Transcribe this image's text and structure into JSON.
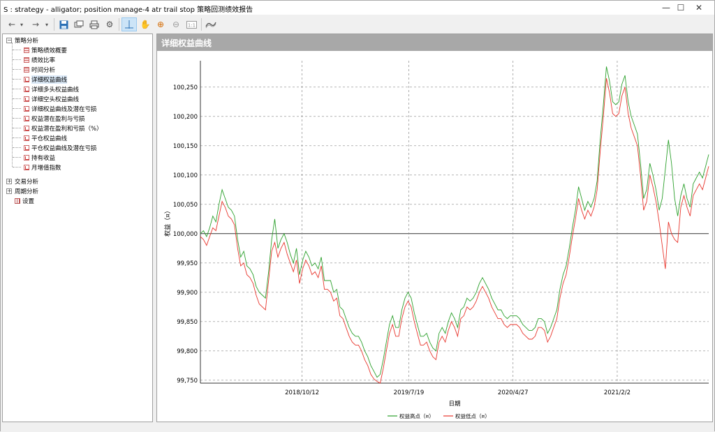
{
  "window": {
    "title": "S : strategy - alligator; position manage-4 atr trail stop 策略回测绩效报告",
    "minimize": "—",
    "maximize": "☐",
    "close": "✕"
  },
  "toolbar": {
    "items": [
      "back-icon",
      "dropdown-icon",
      "forward-icon",
      "dropdown-icon",
      "save-icon",
      "copy-icon",
      "print-icon",
      "settings-icon",
      "crosshair-icon",
      "hand-icon",
      "zoom-in-icon",
      "zoom-out-icon",
      "reset-zoom-icon",
      "wave-icon"
    ]
  },
  "tree": {
    "root1": "策略分析",
    "children": [
      "策略绩效概要",
      "绩效比率",
      "时间分析",
      "详细权益曲线",
      "详细多头权益曲线",
      "详细空头权益曲线",
      "详细权益曲线及潜在亏损",
      "权益潜在盈利与亏损",
      "权益潜在盈利和亏损（%）",
      "平仓权益曲线",
      "平仓权益曲线及潜在亏损",
      "持有收益",
      "月增值指数"
    ],
    "root2": "交易分析",
    "root3": "周期分析",
    "root4": "设置"
  },
  "panel": {
    "title": "详细权益曲线"
  },
  "colors": {
    "high_series": "#2ca02c",
    "low_series": "#e8362d",
    "grid": "#8a8a8a",
    "baseline": "#333333"
  },
  "chart_data": {
    "type": "line",
    "xlabel": "日期",
    "ylabel": "权益（¤）",
    "x_ticks": [
      "2018/10/12",
      "2019/7/19",
      "2020/4/27",
      "2021/2/2"
    ],
    "y_ticks": [
      "99,750",
      "99,800",
      "99,850",
      "99,900",
      "99,950",
      "100,000",
      "100,050",
      "100,100",
      "100,150",
      "100,200",
      "100,250"
    ],
    "ylim": [
      99745,
      100295
    ],
    "baseline": 100000,
    "grid": true,
    "legend_position": "bottom",
    "series": [
      {
        "name": "权益高点（¤）",
        "color": "#2ca02c",
        "values": [
          100000,
          100005,
          99995,
          100010,
          100030,
          100020,
          100050,
          100075,
          100060,
          100045,
          100040,
          100030,
          99990,
          99960,
          99970,
          99945,
          99940,
          99930,
          99910,
          99900,
          99895,
          99890,
          99935,
          99990,
          100025,
          99975,
          99990,
          100000,
          99985,
          99965,
          99950,
          99975,
          99930,
          99955,
          99970,
          99960,
          99945,
          99950,
          99940,
          99960,
          99920,
          99920,
          99920,
          99900,
          99905,
          99875,
          99870,
          99855,
          99840,
          99830,
          99825,
          99825,
          99815,
          99800,
          99790,
          99775,
          99765,
          99755,
          99760,
          99785,
          99815,
          99845,
          99860,
          99840,
          99840,
          99870,
          99890,
          99900,
          99890,
          99865,
          99845,
          99825,
          99825,
          99830,
          99815,
          99805,
          99800,
          99830,
          99840,
          99830,
          99850,
          99865,
          99855,
          99840,
          99870,
          99875,
          99890,
          99885,
          99890,
          99900,
          99915,
          99925,
          99915,
          99905,
          99890,
          99880,
          99870,
          99870,
          99860,
          99855,
          99860,
          99860,
          99860,
          99855,
          99845,
          99840,
          99835,
          99835,
          99840,
          99855,
          99855,
          99850,
          99830,
          99840,
          99855,
          99870,
          99905,
          99930,
          99945,
          99975,
          100010,
          100040,
          100080,
          100060,
          100040,
          100055,
          100045,
          100060,
          100090,
          100160,
          100220,
          100285,
          100260,
          100225,
          100220,
          100225,
          100255,
          100270,
          100225,
          100200,
          100185,
          100170,
          100120,
          100060,
          100075,
          100120,
          100100,
          100075,
          100040,
          100060,
          100110,
          100160,
          100120,
          100060,
          100030,
          100065,
          100085,
          100060,
          100045,
          100085,
          100095,
          100105,
          100095,
          100115,
          100135
        ]
      },
      {
        "name": "权益低点（¤）",
        "color": "#e8362d",
        "values": [
          99995,
          99990,
          99980,
          99995,
          100010,
          100005,
          100030,
          100055,
          100045,
          100030,
          100025,
          100015,
          99975,
          99945,
          99950,
          99930,
          99925,
          99915,
          99895,
          99880,
          99875,
          99870,
          99920,
          99970,
          99985,
          99960,
          99975,
          99985,
          99965,
          99950,
          99935,
          99955,
          99915,
          99940,
          99955,
          99945,
          99930,
          99935,
          99925,
          99945,
          99905,
          99905,
          99900,
          99885,
          99890,
          99860,
          99855,
          99840,
          99825,
          99815,
          99810,
          99810,
          99800,
          99785,
          99775,
          99760,
          99752,
          99748,
          99745,
          99770,
          99800,
          99830,
          99845,
          99825,
          99825,
          99855,
          99875,
          99885,
          99875,
          99850,
          99830,
          99810,
          99810,
          99815,
          99800,
          99790,
          99785,
          99815,
          99825,
          99815,
          99835,
          99850,
          99840,
          99825,
          99855,
          99860,
          99875,
          99870,
          99875,
          99885,
          99900,
          99910,
          99900,
          99890,
          99875,
          99865,
          99855,
          99855,
          99845,
          99840,
          99845,
          99845,
          99845,
          99840,
          99830,
          99825,
          99820,
          99820,
          99825,
          99840,
          99840,
          99835,
          99815,
          99825,
          99840,
          99855,
          99890,
          99915,
          99930,
          99960,
          99995,
          100025,
          100060,
          100040,
          100025,
          100040,
          100030,
          100045,
          100075,
          100140,
          100200,
          100265,
          100240,
          100205,
          100200,
          100205,
          100235,
          100250,
          100205,
          100180,
          100165,
          100150,
          100100,
          100040,
          100055,
          100100,
          100080,
          100055,
          100020,
          99980,
          99940,
          100020,
          100000,
          99990,
          99985,
          100045,
          100065,
          100045,
          100030,
          100065,
          100075,
          100085,
          100075,
          100095,
          100115
        ]
      }
    ]
  }
}
